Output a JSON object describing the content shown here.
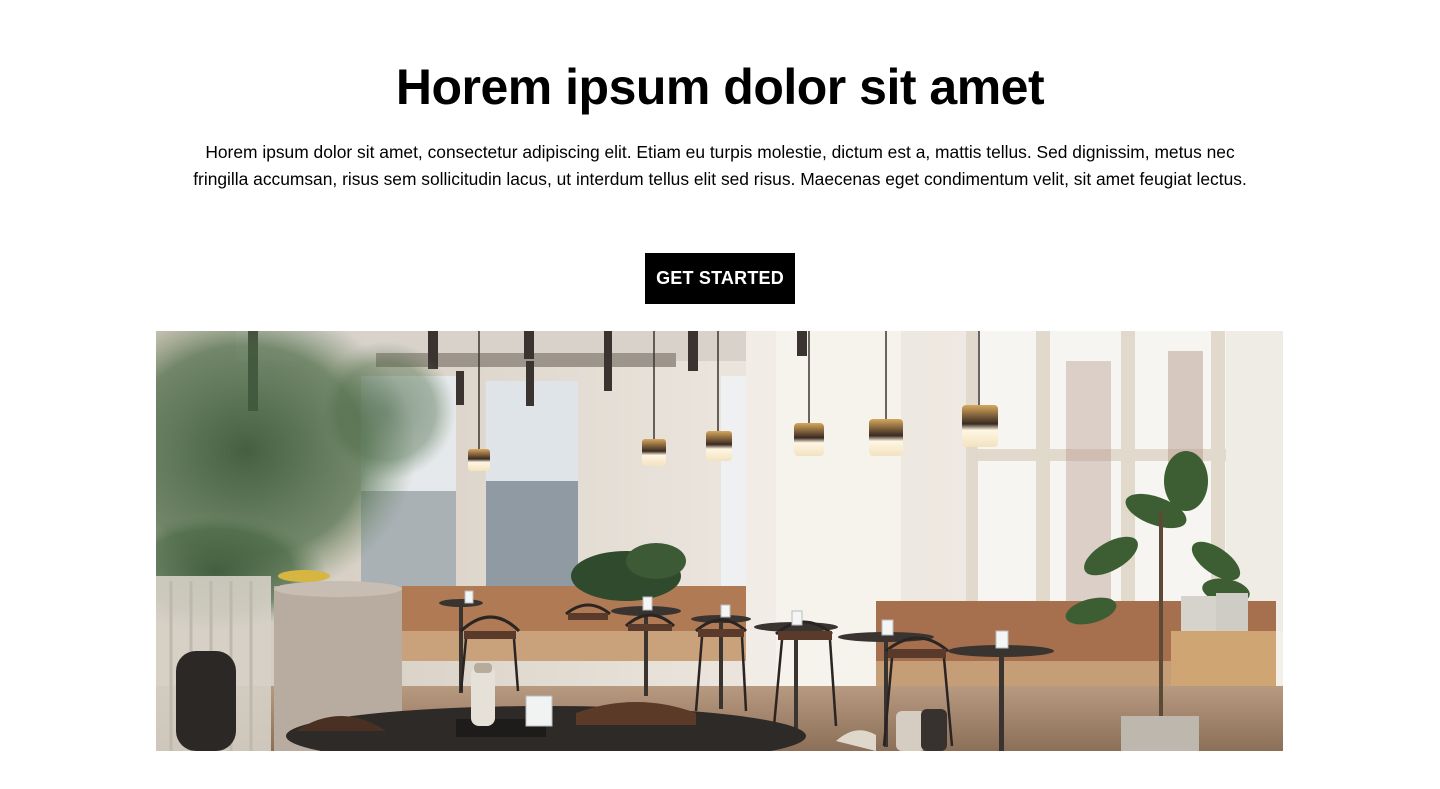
{
  "hero": {
    "title": "Horem ipsum dolor sit amet",
    "description": "Horem ipsum dolor sit amet, consectetur adipiscing elit. Etiam eu turpis molestie, dictum est a, mattis tellus. Sed dignissim, metus nec fringilla accumsan, risus sem sollicitudin lacus, ut interdum tellus elit sed risus. Maecenas eget condimentum velit, sit amet feugiat lectus.",
    "cta_label": "GET STARTED"
  },
  "image": {
    "subject": "cafe interior with pendant lamps, tables, chairs and plants"
  },
  "colors": {
    "background": "#ffffff",
    "text": "#000000",
    "button_bg": "#000000",
    "button_text": "#ffffff"
  }
}
